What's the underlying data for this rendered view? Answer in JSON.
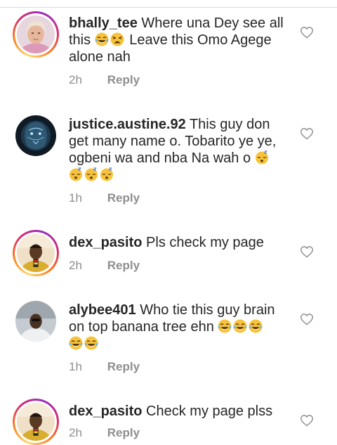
{
  "comments": [
    {
      "username": "bhally_tee",
      "text_before_emoji": "Where una Dey see all this",
      "emojis": [
        "face-with-tears-of-joy",
        "weary-face"
      ],
      "text_after_emoji": "Leave this Omo Agege alone nah",
      "time": "2h",
      "reply": "Reply"
    },
    {
      "username": "justice.austine.92",
      "text_before_emoji": "This guy don get many name o. Tobarito ye ye, ogbeni wa and nba Na wah o",
      "emojis": [
        "sleeping-face",
        "sleeping-face",
        "sleeping-face",
        "sleeping-face"
      ],
      "text_after_emoji": "",
      "time": "1h",
      "reply": "Reply"
    },
    {
      "username": "dex_pasito",
      "text_before_emoji": "Pls check my page",
      "emojis": [],
      "text_after_emoji": "",
      "time": "2h",
      "reply": "Reply"
    },
    {
      "username": "alybee401",
      "text_before_emoji": "Who tie this guy brain on top banana tree ehn",
      "emojis": [
        "face-with-tears-of-joy",
        "face-with-tears-of-joy",
        "face-with-tears-of-joy",
        "face-with-tears-of-joy",
        "face-with-tears-of-joy"
      ],
      "text_after_emoji": "",
      "time": "1h",
      "reply": "Reply"
    },
    {
      "username": "dex_pasito",
      "text_before_emoji": "Check my page plss",
      "emojis": [],
      "text_after_emoji": "",
      "time": "2h",
      "reply": "Reply"
    }
  ],
  "icons": {
    "like": "heart-outline-icon"
  },
  "colors": {
    "text": "#262626",
    "meta": "#8e8e8e",
    "heart": "#8e8e8e",
    "story_ring_start": "#fa7e1e",
    "story_ring_end": "#d62976"
  }
}
